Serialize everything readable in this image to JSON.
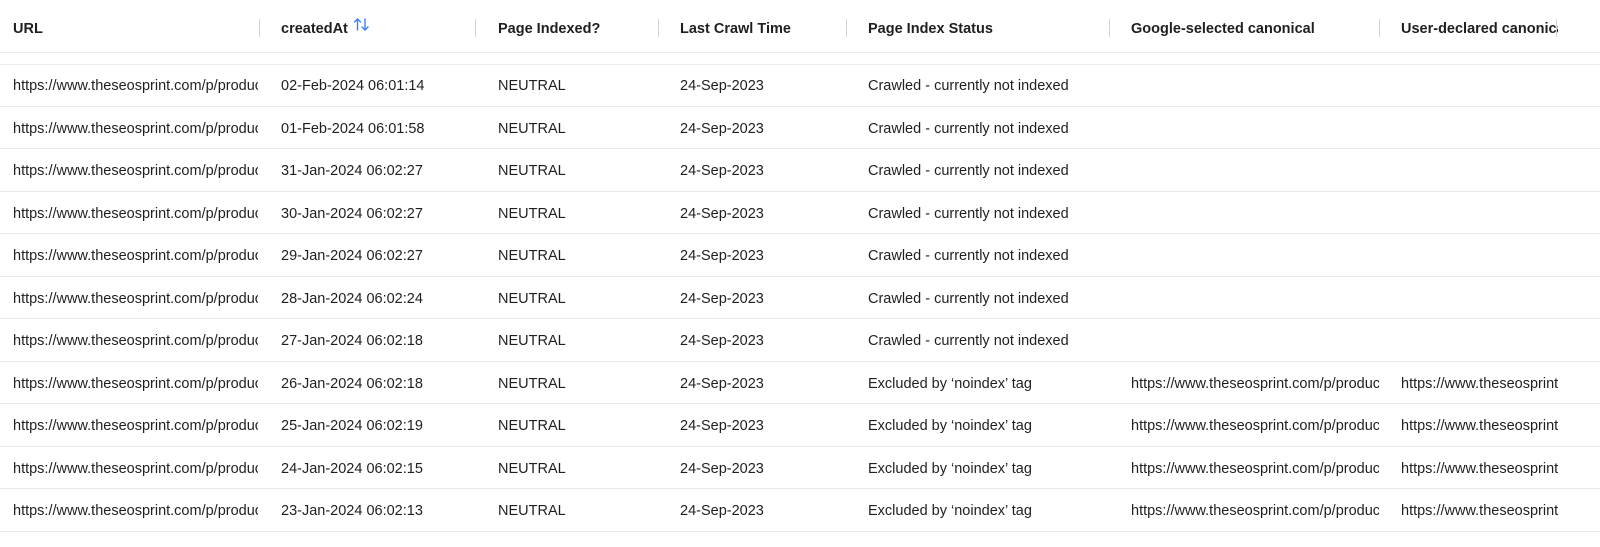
{
  "table": {
    "columns": [
      {
        "key": "url",
        "label": "URL"
      },
      {
        "key": "created",
        "label": "createdAt",
        "sort_icon": "sort-ascending-icon"
      },
      {
        "key": "indexed",
        "label": "Page Indexed?"
      },
      {
        "key": "crawl",
        "label": "Last Crawl Time"
      },
      {
        "key": "status",
        "label": "Page Index Status"
      },
      {
        "key": "google",
        "label": "Google-selected canonical"
      },
      {
        "key": "user",
        "label": "User-declared canonical"
      }
    ],
    "rows": [
      {
        "url": "https://www.theseosprint.com/p/products",
        "created": "02-Feb-2024 06:01:14",
        "indexed": "NEUTRAL",
        "crawl": "24-Sep-2023",
        "status": "Crawled - currently not indexed",
        "google": "",
        "user": ""
      },
      {
        "url": "https://www.theseosprint.com/p/products",
        "created": "01-Feb-2024 06:01:58",
        "indexed": "NEUTRAL",
        "crawl": "24-Sep-2023",
        "status": "Crawled - currently not indexed",
        "google": "",
        "user": ""
      },
      {
        "url": "https://www.theseosprint.com/p/products",
        "created": "31-Jan-2024 06:02:27",
        "indexed": "NEUTRAL",
        "crawl": "24-Sep-2023",
        "status": "Crawled - currently not indexed",
        "google": "",
        "user": ""
      },
      {
        "url": "https://www.theseosprint.com/p/products",
        "created": "30-Jan-2024 06:02:27",
        "indexed": "NEUTRAL",
        "crawl": "24-Sep-2023",
        "status": "Crawled - currently not indexed",
        "google": "",
        "user": ""
      },
      {
        "url": "https://www.theseosprint.com/p/products",
        "created": "29-Jan-2024 06:02:27",
        "indexed": "NEUTRAL",
        "crawl": "24-Sep-2023",
        "status": "Crawled - currently not indexed",
        "google": "",
        "user": ""
      },
      {
        "url": "https://www.theseosprint.com/p/products",
        "created": "28-Jan-2024 06:02:24",
        "indexed": "NEUTRAL",
        "crawl": "24-Sep-2023",
        "status": "Crawled - currently not indexed",
        "google": "",
        "user": ""
      },
      {
        "url": "https://www.theseosprint.com/p/products",
        "created": "27-Jan-2024 06:02:18",
        "indexed": "NEUTRAL",
        "crawl": "24-Sep-2023",
        "status": "Crawled - currently not indexed",
        "google": "",
        "user": ""
      },
      {
        "url": "https://www.theseosprint.com/p/products",
        "created": "26-Jan-2024 06:02:18",
        "indexed": "NEUTRAL",
        "crawl": "24-Sep-2023",
        "status": "Excluded by ‘noindex’ tag",
        "google": "https://www.theseosprint.com/p/products",
        "user": "https://www.theseosprint.com/p/products"
      },
      {
        "url": "https://www.theseosprint.com/p/products",
        "created": "25-Jan-2024 06:02:19",
        "indexed": "NEUTRAL",
        "crawl": "24-Sep-2023",
        "status": "Excluded by ‘noindex’ tag",
        "google": "https://www.theseosprint.com/p/products",
        "user": "https://www.theseosprint.com/p/products"
      },
      {
        "url": "https://www.theseosprint.com/p/products",
        "created": "24-Jan-2024 06:02:15",
        "indexed": "NEUTRAL",
        "crawl": "24-Sep-2023",
        "status": "Excluded by ‘noindex’ tag",
        "google": "https://www.theseosprint.com/p/products",
        "user": "https://www.theseosprint.com/p/products"
      },
      {
        "url": "https://www.theseosprint.com/p/products",
        "created": "23-Jan-2024 06:02:13",
        "indexed": "NEUTRAL",
        "crawl": "24-Sep-2023",
        "status": "Excluded by ‘noindex’ tag",
        "google": "https://www.theseosprint.com/p/products",
        "user": "https://www.theseosprint.com/p/products"
      }
    ]
  },
  "colors": {
    "accent": "#3b82f6",
    "text": "#1f1f1f",
    "row_border": "#e9e9e9",
    "header_separator": "#d4d4d4"
  }
}
